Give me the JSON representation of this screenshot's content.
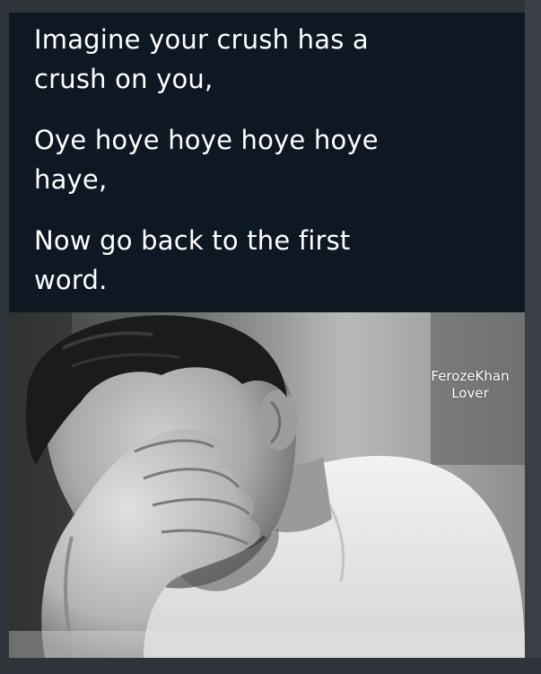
{
  "caption": {
    "lines": [
      "Imagine your crush has a",
      "crush on you,",
      "Oye hoye hoye hoye hoye",
      "haye,",
      "Now go back to the first",
      "word."
    ]
  },
  "photo": {
    "watermark_line1": "FerozeKhan",
    "watermark_line2": "Lover",
    "style": "black-and-white"
  },
  "colors": {
    "caption_bg": "#0e1823",
    "caption_text": "#ffffff",
    "outer_bg": "#2f343b"
  }
}
